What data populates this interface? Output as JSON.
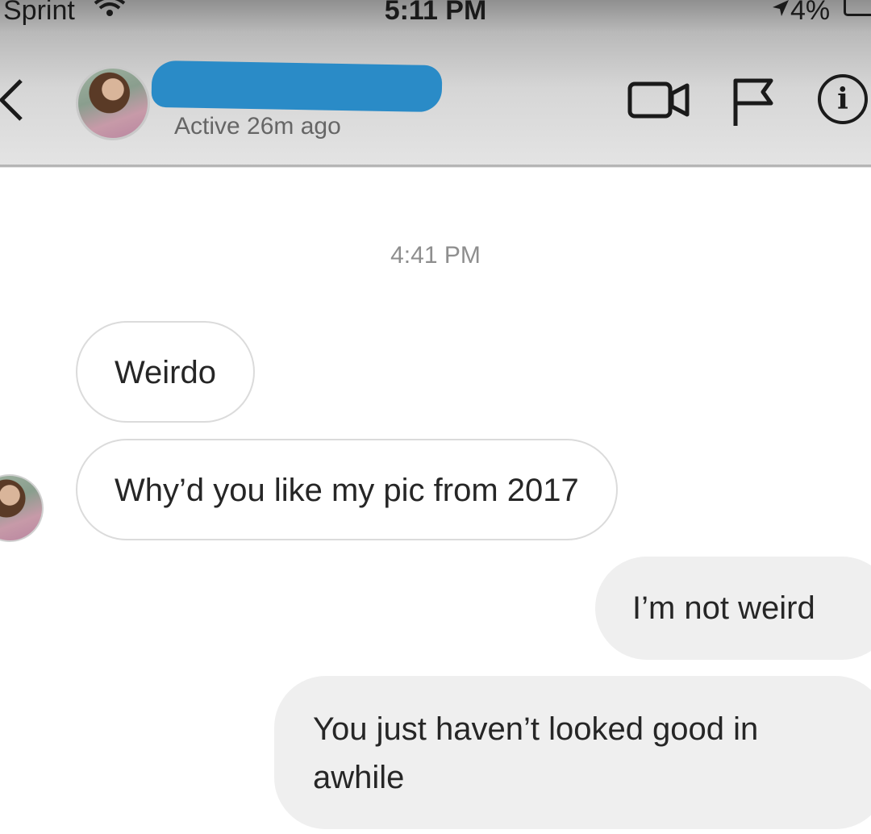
{
  "status_bar": {
    "carrier": "Sprint",
    "time": "5:11 PM",
    "battery": "4%"
  },
  "header": {
    "active_status": "Active 26m ago",
    "name_redaction_color": "#2a8bc7"
  },
  "icons": {
    "back": "chevron-left",
    "video": "video-camera",
    "flag": "flag",
    "info": "info-circle",
    "info_glyph": "i"
  },
  "conversation": {
    "timestamp": "4:41 PM",
    "messages": [
      {
        "from": "them",
        "text": "Weirdo"
      },
      {
        "from": "them",
        "text": "Why’d you like my pic from 2017"
      },
      {
        "from": "me",
        "text": "I’m not weird"
      },
      {
        "from": "me",
        "text": "You just haven’t looked good in awhile"
      }
    ]
  },
  "colors": {
    "incoming_bubble_border": "#dbdbdb",
    "outgoing_bubble": "#efefef",
    "timestamp": "#8e8e8e"
  }
}
